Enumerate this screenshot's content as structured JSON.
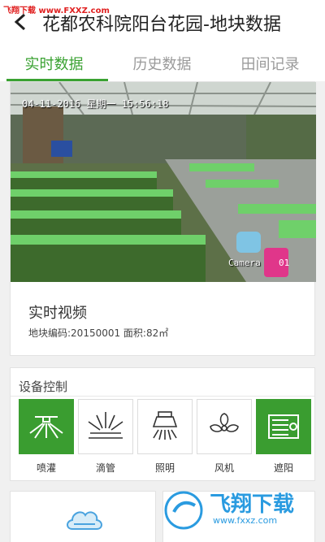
{
  "watermark": {
    "site": "飞翔下载",
    "url": "www.FXXZ.com",
    "brand": "飞翔下载",
    "brand_url": "www.fxxz.com"
  },
  "header": {
    "title": "花都农科院阳台花园-地块数据",
    "back_icon": "chevron-left-icon"
  },
  "tabs": [
    {
      "label": "实时数据",
      "active": true
    },
    {
      "label": "历史数据",
      "active": false
    },
    {
      "label": "田间记录",
      "active": false
    }
  ],
  "video": {
    "timestamp": "04-11-2016 星期一 15:56:18",
    "camera_label": "Camera",
    "camera_number": "01",
    "title": "实时视频",
    "meta": "地块编码:20150001 面积:82㎡"
  },
  "controls": {
    "title": "设备控制",
    "active_color": "#3a9d30",
    "devices": [
      {
        "label": "喷灌",
        "icon": "sprinkler-icon",
        "on": true
      },
      {
        "label": "滴管",
        "icon": "drip-irrigation-icon",
        "on": false
      },
      {
        "label": "照明",
        "icon": "lamp-icon",
        "on": false
      },
      {
        "label": "风机",
        "icon": "fan-icon",
        "on": false
      },
      {
        "label": "遮阳",
        "icon": "sunshade-icon",
        "on": true
      }
    ]
  },
  "weather": {
    "icon": "cloud-icon"
  }
}
